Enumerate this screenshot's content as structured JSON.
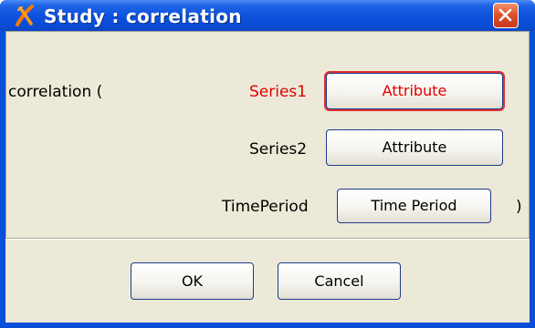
{
  "window": {
    "title": "Study : correlation"
  },
  "form": {
    "prefix_label": "correlation (",
    "suffix_label": ")",
    "rows": [
      {
        "label": "Series1",
        "button": "Attribute",
        "highlight": true
      },
      {
        "label": "Series2",
        "button": "Attribute",
        "highlight": false
      },
      {
        "label": "TimePeriod",
        "button": "Time Period",
        "highlight": false
      }
    ]
  },
  "buttons": {
    "ok": "OK",
    "cancel": "Cancel"
  },
  "colors": {
    "title_bar": "#0c50dc",
    "highlight_red": "#e00000",
    "dialog_bg": "#ece9d8",
    "button_border": "#1e3b8b"
  },
  "icons": {
    "app": "x-logo-icon",
    "close": "close-icon"
  }
}
